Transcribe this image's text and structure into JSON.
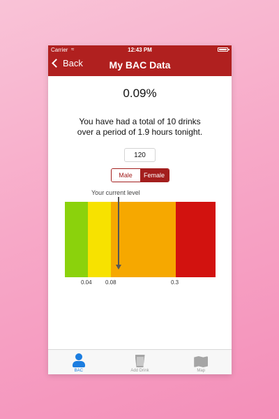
{
  "status": {
    "carrier": "Carrier",
    "time": "12:43 PM"
  },
  "nav": {
    "back_label": "Back",
    "title": "My BAC Data"
  },
  "bac": {
    "value": "0.09%",
    "summary_line1": "You have had a total of 10 drinks",
    "summary_line2": "over a period of 1.9 hours tonight."
  },
  "weight": {
    "value": "120"
  },
  "gender": {
    "options": [
      "Male",
      "Female"
    ],
    "selected": "Female"
  },
  "level_chart": {
    "pointer_label": "Your current level",
    "current_level": 0.09,
    "ticks": [
      "0.04",
      "0.08",
      "0.3"
    ],
    "zones": [
      {
        "color": "#8bd20c"
      },
      {
        "color": "#f7e200"
      },
      {
        "color": "#f6a800"
      },
      {
        "color": "#d2120f"
      }
    ]
  },
  "tabbar": {
    "tabs": [
      {
        "label": "BAC",
        "icon": "person-icon",
        "active": true
      },
      {
        "label": "Add Drink",
        "icon": "cup-icon",
        "active": false
      },
      {
        "label": "Map",
        "icon": "map-icon",
        "active": false
      }
    ]
  }
}
